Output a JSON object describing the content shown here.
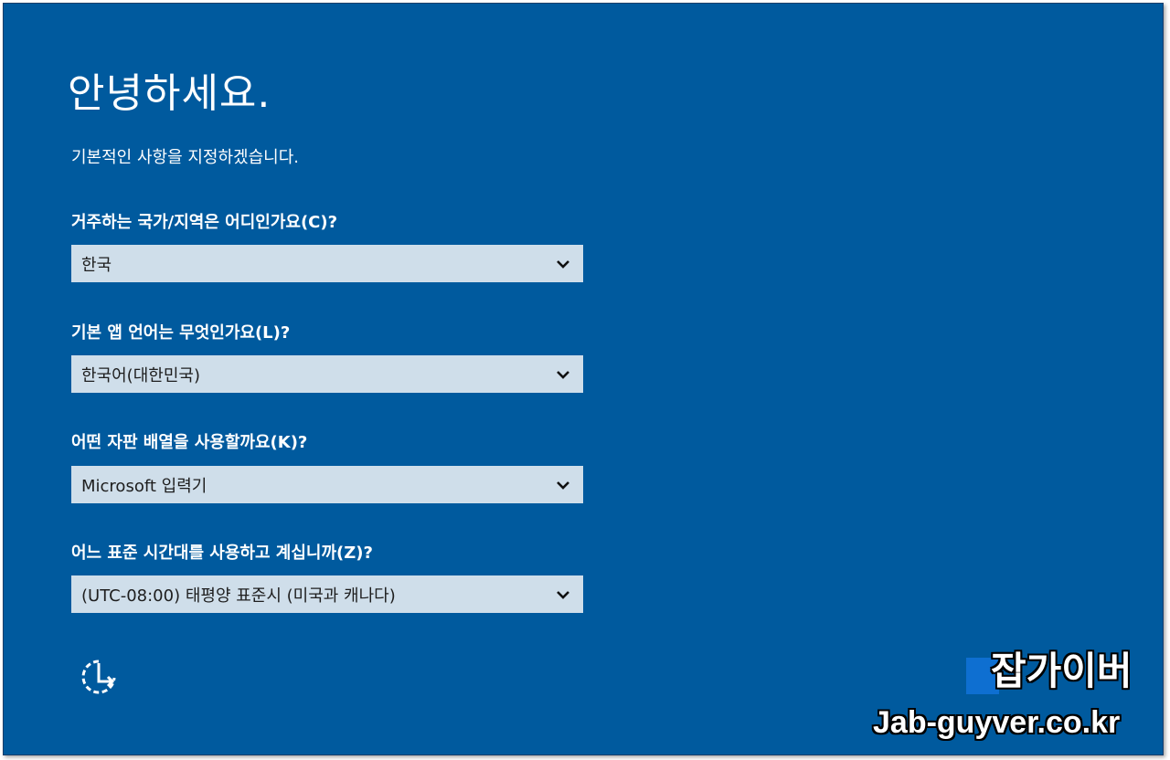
{
  "colors": {
    "background": "#005a9e",
    "dropdown_bg": "#cfdeea",
    "text_light": "#ffffff",
    "text_dark": "#1e1e1e"
  },
  "setup": {
    "title": "안녕하세요.",
    "subtitle": "기본적인 사항을 지정하겠습니다.",
    "region": {
      "label": "거주하는 국가/지역은 어디인가요(C)?",
      "value": "한국"
    },
    "app_language": {
      "label": "기본 앱 언어는 무엇인가요(L)?",
      "value": "한국어(대한민국)"
    },
    "keyboard": {
      "label": "어떤 자판 배열을 사용할까요(K)?",
      "value": "Microsoft 입력기"
    },
    "timezone": {
      "label": "어느 표준 시간대를 사용하고 계십니까(Z)?",
      "value": "(UTC-08:00) 태평양 표준시 (미국과 캐나다)"
    },
    "icons": {
      "chevron": "chevron-down-icon",
      "accessibility": "ease-of-access-icon"
    }
  },
  "watermark": {
    "korean": "잡가이버",
    "url": "Jab-guyver.co.kr"
  }
}
